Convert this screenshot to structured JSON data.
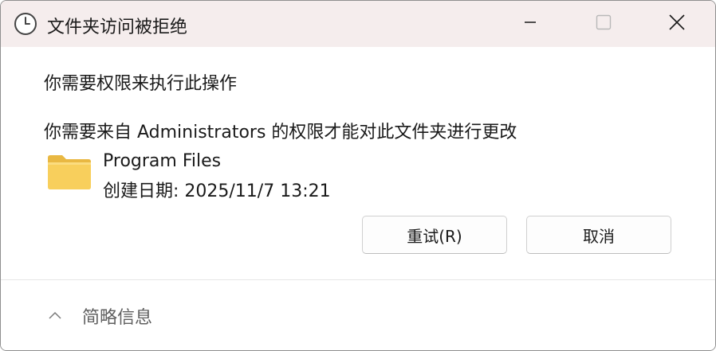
{
  "window": {
    "title": "文件夹访问被拒绝",
    "icon": "clock-icon",
    "titlebar_color": "#f5eded"
  },
  "controls": {
    "minimize_icon": "minimize-icon",
    "maximize_icon": "maximize-icon",
    "close_icon": "close-icon"
  },
  "message": {
    "headline": "你需要权限来执行此操作",
    "description": "你需要来自 Administrators 的权限才能对此文件夹进行更改"
  },
  "item": {
    "icon": "folder-icon",
    "name": "Program Files",
    "created": "创建日期: 2025/11/7 13:21"
  },
  "buttons": {
    "retry": "重试(R)",
    "cancel": "取消"
  },
  "footer": {
    "toggle_icon": "chevron-up-icon",
    "details_label": "简略信息"
  }
}
